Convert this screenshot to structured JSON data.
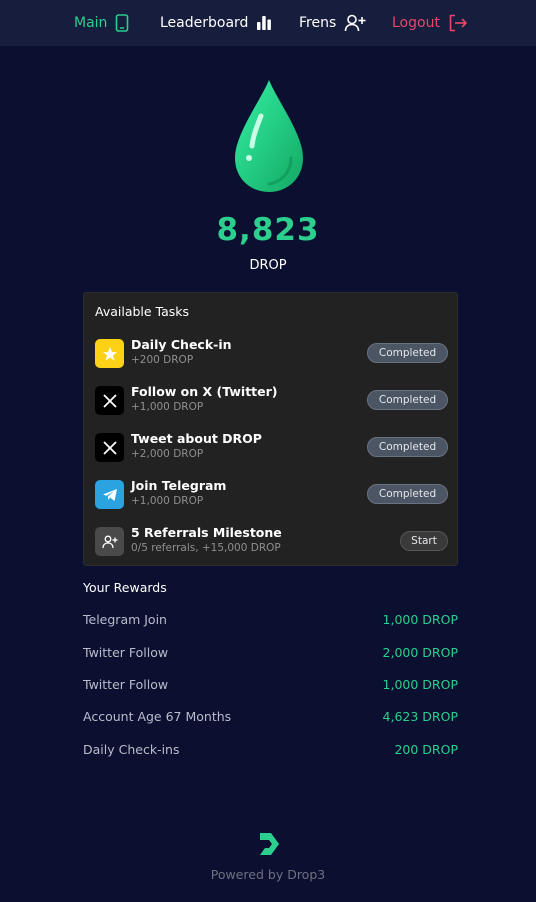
{
  "nav": {
    "main_label": "Main",
    "leaderboard_label": "Leaderboard",
    "frens_label": "Frens",
    "logout_label": "Logout"
  },
  "hero": {
    "balance": "8,823",
    "unit": "DROP"
  },
  "tasks": {
    "title": "Available Tasks",
    "items": [
      {
        "name": "Daily Check-in",
        "reward": "+200 DROP",
        "button": "Completed",
        "icon": "star-icon"
      },
      {
        "name": "Follow on X (Twitter)",
        "reward": "+1,000 DROP",
        "button": "Completed",
        "icon": "x-logo-icon"
      },
      {
        "name": "Tweet about DROP",
        "reward": "+2,000 DROP",
        "button": "Completed",
        "icon": "x-logo-icon"
      },
      {
        "name": "Join Telegram",
        "reward": "+1,000 DROP",
        "button": "Completed",
        "icon": "telegram-icon"
      },
      {
        "name": "5 Referrals Milestone",
        "reward": "0/5 referrals, +15,000 DROP",
        "button": "Start",
        "icon": "user-plus-icon"
      }
    ]
  },
  "rewards": {
    "title": "Your Rewards",
    "items": [
      {
        "label": "Telegram Join",
        "amount": "1,000 DROP"
      },
      {
        "label": "Twitter Follow",
        "amount": "2,000 DROP"
      },
      {
        "label": "Twitter Follow",
        "amount": "1,000 DROP"
      },
      {
        "label": "Account Age 67 Months",
        "amount": "4,623 DROP"
      },
      {
        "label": "Daily Check-ins",
        "amount": "200 DROP"
      }
    ]
  },
  "footer": {
    "powered_by": "Powered by Drop3"
  },
  "colors": {
    "background": "#0b1030",
    "nav_background": "#171d3c",
    "accent_green": "#2ccf8e",
    "logout_red": "#e8476a",
    "panel": "#222222"
  }
}
